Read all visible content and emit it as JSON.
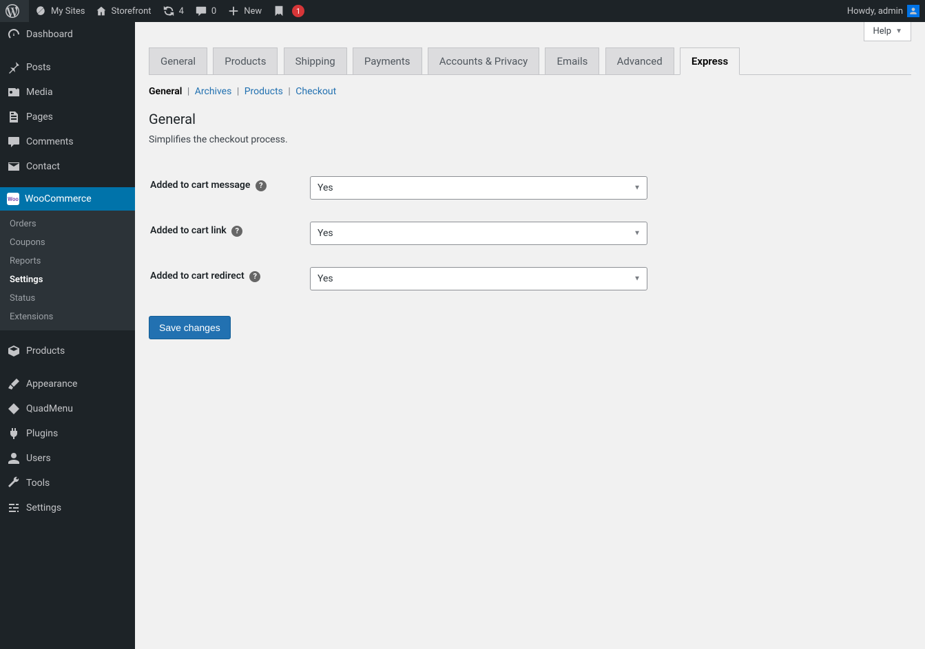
{
  "adminbar": {
    "my_sites": "My Sites",
    "site_name": "Storefront",
    "updates_count": "4",
    "comments_count": "0",
    "new_label": "New",
    "yoast_count": "1",
    "howdy": "Howdy, admin"
  },
  "sidebar": {
    "dashboard": "Dashboard",
    "posts": "Posts",
    "media": "Media",
    "pages": "Pages",
    "comments": "Comments",
    "contact": "Contact",
    "woocommerce": "WooCommerce",
    "woo_sub": {
      "orders": "Orders",
      "coupons": "Coupons",
      "reports": "Reports",
      "settings": "Settings",
      "status": "Status",
      "extensions": "Extensions"
    },
    "products": "Products",
    "appearance": "Appearance",
    "quadmenu": "QuadMenu",
    "plugins": "Plugins",
    "users": "Users",
    "tools": "Tools",
    "settings": "Settings"
  },
  "help_label": "Help",
  "tabs": {
    "general": "General",
    "products": "Products",
    "shipping": "Shipping",
    "payments": "Payments",
    "accounts_privacy": "Accounts & Privacy",
    "emails": "Emails",
    "advanced": "Advanced",
    "express": "Express"
  },
  "subsections": {
    "general": "General",
    "archives": "Archives",
    "products": "Products",
    "checkout": "Checkout"
  },
  "section_title": "General",
  "section_desc": "Simplifies the checkout process.",
  "fields": {
    "added_to_cart_message": {
      "label": "Added to cart message",
      "value": "Yes"
    },
    "added_to_cart_link": {
      "label": "Added to cart link",
      "value": "Yes"
    },
    "added_to_cart_redirect": {
      "label": "Added to cart redirect",
      "value": "Yes"
    }
  },
  "save_button": "Save changes"
}
